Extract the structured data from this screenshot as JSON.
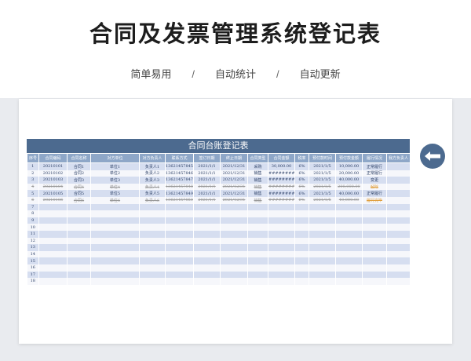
{
  "header": {
    "title": "合同及发票管理系统登记表",
    "features": [
      "简单易用",
      "自动统计",
      "自动更新"
    ],
    "separator": "/"
  },
  "sheet": {
    "title": "合同台账登记表",
    "columns": [
      "序号",
      "合同编码",
      "合同名称",
      "对方单位",
      "对方负责人",
      "联系方式",
      "签订日期",
      "终止日期",
      "合同类型",
      "合同金额",
      "税率",
      "预付款时间",
      "预付款金额",
      "履行情况",
      "我方负责人"
    ],
    "rows": [
      {
        "style": "odd",
        "cells": [
          "1",
          "20210101",
          "合同1",
          "单位1",
          "负责人1",
          "13621457845",
          "2021/1/1",
          "2021/12/31",
          "采购",
          "30,000.00",
          "6%",
          "2021/1/5",
          "10,000.00",
          "正常履行",
          ""
        ]
      },
      {
        "style": "even",
        "cells": [
          "2",
          "20210102",
          "合同2",
          "单位2",
          "负责人2",
          "13621457846",
          "2021/1/1",
          "2021/12/31",
          "销售",
          "##########",
          "6%",
          "2021/1/5",
          "20,000.00",
          "正常履行",
          ""
        ]
      },
      {
        "style": "odd",
        "cells": [
          "3",
          "20210103",
          "合同3",
          "单位3",
          "负责人3",
          "13621457847",
          "2021/1/1",
          "2021/12/31",
          "销售",
          "##########",
          "6%",
          "2021/1/5",
          "40,000.00",
          "变更",
          ""
        ]
      },
      {
        "style": "even strike",
        "cells": [
          "4",
          "20210104",
          "合同4",
          "单位4",
          "负责人4",
          "13621457848",
          "2021/1/1",
          "2021/12/31",
          "销售",
          "##########",
          "6%",
          "2021/1/5",
          "200,000.00",
          "解除",
          ""
        ]
      },
      {
        "style": "odd",
        "cells": [
          "5",
          "20210105",
          "合同5",
          "单位5",
          "负责人5",
          "13621457849",
          "2021/1/1",
          "2021/12/31",
          "销售",
          "##########",
          "6%",
          "2021/1/5",
          "40,000.00",
          "正常履行",
          ""
        ]
      },
      {
        "style": "even strike",
        "cells": [
          "6",
          "20210106",
          "合同6",
          "单位6",
          "负责人6",
          "13621457850",
          "2021/1/1",
          "2021/12/31",
          "销售",
          "##########",
          "6%",
          "2021/1/5",
          "40,000.00",
          "履行完毕",
          ""
        ]
      },
      {
        "style": "odd",
        "cells": [
          "7",
          "",
          "",
          "",
          "",
          "",
          "",
          "",
          "",
          "",
          "",
          "",
          "",
          "",
          ""
        ]
      },
      {
        "style": "even",
        "cells": [
          "8",
          "",
          "",
          "",
          "",
          "",
          "",
          "",
          "",
          "",
          "",
          "",
          "",
          "",
          ""
        ]
      },
      {
        "style": "odd",
        "cells": [
          "9",
          "",
          "",
          "",
          "",
          "",
          "",
          "",
          "",
          "",
          "",
          "",
          "",
          "",
          ""
        ]
      },
      {
        "style": "even",
        "cells": [
          "10",
          "",
          "",
          "",
          "",
          "",
          "",
          "",
          "",
          "",
          "",
          "",
          "",
          "",
          ""
        ]
      },
      {
        "style": "odd",
        "cells": [
          "11",
          "",
          "",
          "",
          "",
          "",
          "",
          "",
          "",
          "",
          "",
          "",
          "",
          "",
          ""
        ]
      },
      {
        "style": "even",
        "cells": [
          "12",
          "",
          "",
          "",
          "",
          "",
          "",
          "",
          "",
          "",
          "",
          "",
          "",
          "",
          ""
        ]
      },
      {
        "style": "odd",
        "cells": [
          "13",
          "",
          "",
          "",
          "",
          "",
          "",
          "",
          "",
          "",
          "",
          "",
          "",
          "",
          ""
        ]
      },
      {
        "style": "even",
        "cells": [
          "14",
          "",
          "",
          "",
          "",
          "",
          "",
          "",
          "",
          "",
          "",
          "",
          "",
          "",
          ""
        ]
      },
      {
        "style": "odd",
        "cells": [
          "15",
          "",
          "",
          "",
          "",
          "",
          "",
          "",
          "",
          "",
          "",
          "",
          "",
          "",
          ""
        ]
      },
      {
        "style": "even",
        "cells": [
          "16",
          "",
          "",
          "",
          "",
          "",
          "",
          "",
          "",
          "",
          "",
          "",
          "",
          "",
          ""
        ]
      },
      {
        "style": "odd",
        "cells": [
          "17",
          "",
          "",
          "",
          "",
          "",
          "",
          "",
          "",
          "",
          "",
          "",
          "",
          "",
          ""
        ]
      },
      {
        "style": "even",
        "cells": [
          "18",
          "",
          "",
          "",
          "",
          "",
          "",
          "",
          "",
          "",
          "",
          "",
          "",
          "",
          ""
        ]
      }
    ]
  },
  "nav": {
    "back_icon": "arrow-left-icon"
  },
  "colors": {
    "accent": "#4c6a8f",
    "header_row": "#8ea7c8",
    "band": "#d6def0"
  }
}
